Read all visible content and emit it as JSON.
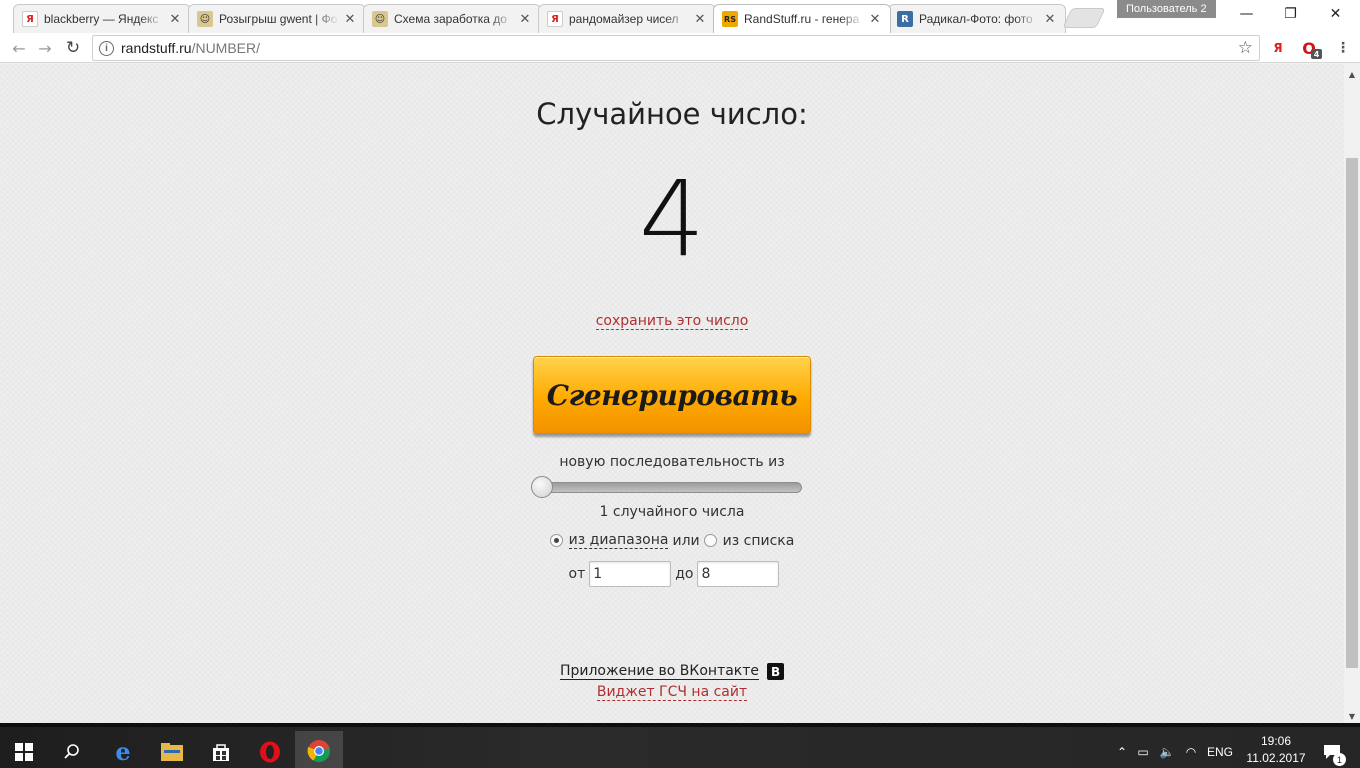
{
  "browser": {
    "tabs": [
      {
        "title": "blackberry — Яндекс",
        "favicon": "yandex-icon",
        "active": false
      },
      {
        "title": "Розыгрыш gwent | Фо",
        "favicon": "avatar-icon",
        "active": false
      },
      {
        "title": "Схема заработка до",
        "favicon": "avatar-icon",
        "active": false
      },
      {
        "title": "рандомайзер чисел",
        "favicon": "yandex-icon",
        "active": false
      },
      {
        "title": "RandStuff.ru - генера",
        "favicon": "randstuff-icon",
        "active": true
      },
      {
        "title": "Радикал-Фото: фото",
        "favicon": "radikal-icon",
        "active": false
      }
    ],
    "profile_label": "Пользователь 2",
    "url_host": "randstuff.ru",
    "url_path": "/NUMBER/",
    "opera_badge": "4"
  },
  "page": {
    "heading": "Случайное число:",
    "result": "4",
    "save_link": "сохранить это число",
    "generate_button": "Сгенерировать",
    "sequence_label": "новую последовательность из",
    "slider_value_fraction": 0,
    "count_label": "1 случайного числа",
    "mode_range_label": "из диапазона",
    "mode_or": "или",
    "mode_list_label": "из списка",
    "mode_selected": "range",
    "from_label": "от",
    "from_value": "1",
    "to_label": "до",
    "to_value": "8",
    "vk_link": "Приложение во ВКонтакте",
    "vk_badge": "В",
    "widget_link": "Виджет ГСЧ на сайт"
  },
  "taskbar": {
    "language": "ENG",
    "time": "19:06",
    "date": "11.02.2017",
    "notification_count": "1"
  },
  "colors": {
    "link_red": "#b03030",
    "button_orange": "#ffaa00",
    "taskbar_bg": "#222222"
  }
}
